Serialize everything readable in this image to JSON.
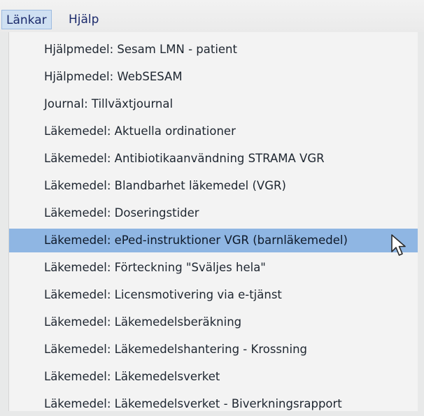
{
  "menubar": {
    "items": [
      {
        "label": "Länkar"
      },
      {
        "label": "Hjälp"
      }
    ]
  },
  "dropdown": {
    "items": [
      {
        "label": "Hjälpmedel: Sesam LMN - patient"
      },
      {
        "label": "Hjälpmedel: WebSESAM"
      },
      {
        "label": "Journal: Tillväxtjournal"
      },
      {
        "label": "Läkemedel: Aktuella ordinationer"
      },
      {
        "label": "Läkemedel: Antibiotikaanvändning STRAMA VGR"
      },
      {
        "label": "Läkemedel: Blandbarhet läkemedel (VGR)"
      },
      {
        "label": "Läkemedel: Doseringstider"
      },
      {
        "label": "Läkemedel: ePed-instruktioner VGR (barnläkemedel)"
      },
      {
        "label": "Läkemedel: Förteckning \"Sväljes hela\""
      },
      {
        "label": "Läkemedel: Licensmotivering via e-tjänst"
      },
      {
        "label": "Läkemedel: Läkemedelsberäkning"
      },
      {
        "label": "Läkemedel: Läkemedelshantering - Krossning"
      },
      {
        "label": "Läkemedel: Läkemedelsverket"
      },
      {
        "label": "Läkemedel: Läkemedelsverket - Biverkningsrapport"
      }
    ],
    "highlighted_index": 7
  }
}
